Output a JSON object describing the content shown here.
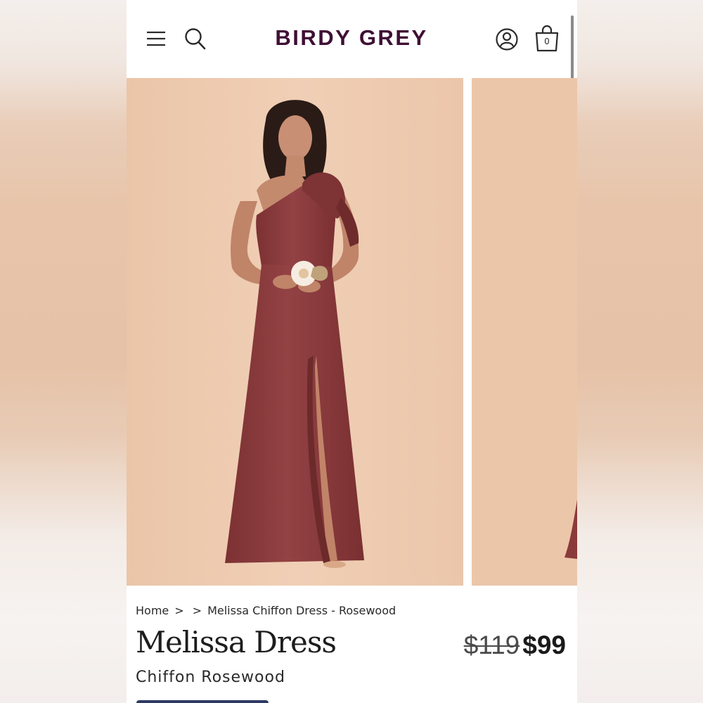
{
  "header": {
    "logo": "BIRDY GREY",
    "cart_count": "0",
    "icons": [
      "menu-icon",
      "search-icon",
      "account-icon",
      "shopping-bag-icon"
    ]
  },
  "gallery": {
    "background_color": "#ecc8ad",
    "dress_color": "#8b3a3a"
  },
  "breadcrumb": {
    "home": "Home",
    "separator": ">",
    "current": "Melissa Chiffon Dress - Rosewood"
  },
  "product": {
    "name": "Melissa Dress",
    "variant": "Chiffon Rosewood",
    "original_price": "$119",
    "sale_price": "$99"
  },
  "colors": {
    "brand": "#3f0f35",
    "cta": "#2c3a63"
  }
}
